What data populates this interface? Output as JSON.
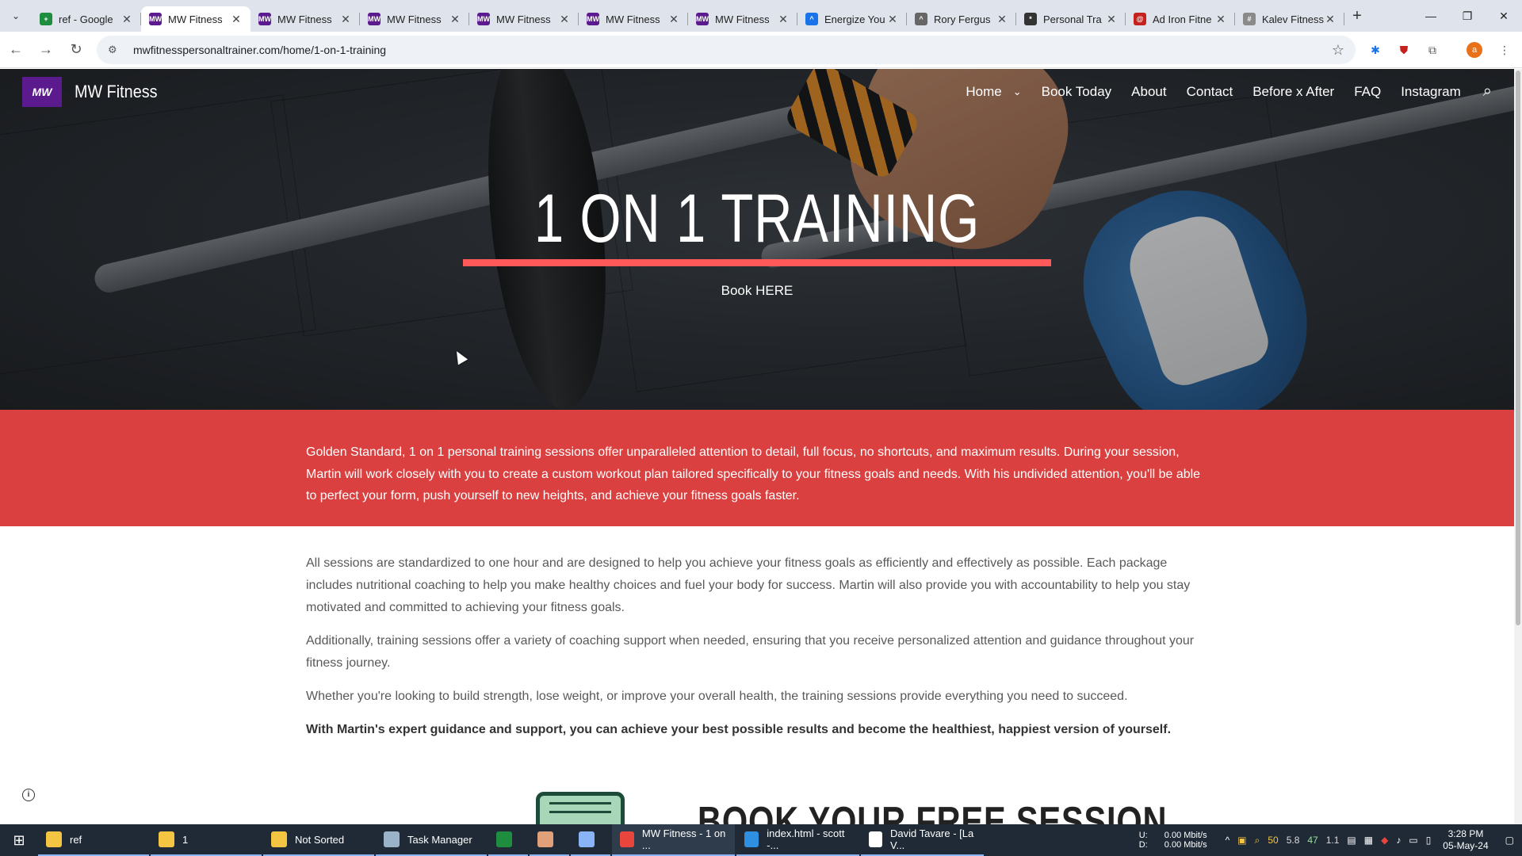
{
  "browser": {
    "tabs": [
      {
        "title": "ref - Google",
        "favicon_color": "#1e8e3e",
        "favicon_glyph": "+",
        "active": false
      },
      {
        "title": "MW Fitness",
        "favicon_color": "#5b1a8e",
        "favicon_glyph": "MW",
        "active": true
      },
      {
        "title": "MW Fitness",
        "favicon_color": "#5b1a8e",
        "favicon_glyph": "MW",
        "active": false
      },
      {
        "title": "MW Fitness",
        "favicon_color": "#5b1a8e",
        "favicon_glyph": "MW",
        "active": false
      },
      {
        "title": "MW Fitness",
        "favicon_color": "#5b1a8e",
        "favicon_glyph": "MW",
        "active": false
      },
      {
        "title": "MW Fitness",
        "favicon_color": "#5b1a8e",
        "favicon_glyph": "MW",
        "active": false
      },
      {
        "title": "MW Fitness",
        "favicon_color": "#5b1a8e",
        "favicon_glyph": "MW",
        "active": false
      },
      {
        "title": "Energize You",
        "favicon_color": "#1a73e8",
        "favicon_glyph": "^",
        "active": false
      },
      {
        "title": "Rory Fergus",
        "favicon_color": "#666666",
        "favicon_glyph": "^",
        "active": false
      },
      {
        "title": "Personal Tra",
        "favicon_color": "#333333",
        "favicon_glyph": "*",
        "active": false
      },
      {
        "title": "Ad Iron Fitne",
        "favicon_color": "#c5221f",
        "favicon_glyph": "@",
        "active": false
      },
      {
        "title": "Kalev Fitness",
        "favicon_color": "#8a8a8a",
        "favicon_glyph": "#",
        "active": false
      }
    ],
    "url": "mwfitnesspersonaltrainer.com/home/1-on-1-training",
    "profile_initial": "a"
  },
  "site": {
    "logo_text": "MW",
    "brand": "MW Fitness",
    "nav": [
      "Home",
      "Book Today",
      "About",
      "Contact",
      "Before x After",
      "FAQ",
      "Instagram"
    ],
    "hero_title": "1 ON 1 TRAINING",
    "hero_button": "Book HERE",
    "intro": "Golden Standard, 1 on 1 personal training sessions offer unparalleled attention to detail, full focus, no shortcuts, and maximum results. During your session, Martin will work closely with you to create a custom workout plan tailored specifically to your fitness goals and needs. With his undivided attention, you'll be able to perfect your form, push yourself to new heights, and achieve your fitness goals faster.",
    "paragraphs": [
      "All sessions are standardized to one hour and are designed to help you achieve your fitness goals as efficiently and effectively as possible. Each package includes nutritional coaching to help you make healthy choices and fuel your body for success. Martin will also provide you with accountability to help you stay motivated and committed to achieving your fitness goals.",
      "Additionally, training sessions offer a variety of coaching support when needed, ensuring that you receive personalized attention and guidance throughout your fitness journey.",
      "Whether you're looking to build strength, lose weight, or improve your overall health, the training sessions provide everything you need to succeed."
    ],
    "closing": "With Martin's expert guidance and support, you can achieve your best possible results and become the healthiest, happiest version of yourself.",
    "next_heading": "BOOK YOUR FREE SESSION",
    "accent_color": "#ff5959",
    "band_color": "#d9403f"
  },
  "taskbar": {
    "items": [
      {
        "label": "ref",
        "icon": "folder-icon",
        "color": "#f4c542"
      },
      {
        "label": "1",
        "icon": "folder-icon",
        "color": "#f4c542"
      },
      {
        "label": "Not Sorted",
        "icon": "folder-icon",
        "color": "#f4c542"
      },
      {
        "label": "Task Manager",
        "icon": "task-manager-icon",
        "color": "#9ab3c9"
      },
      {
        "label": "",
        "icon": "sheets-icon",
        "color": "#1e8e3e"
      },
      {
        "label": "",
        "icon": "app-icon",
        "color": "#e0a07a"
      },
      {
        "label": "",
        "icon": "notepad-icon",
        "color": "#8ab4f8"
      },
      {
        "label": "MW Fitness - 1 on ...",
        "icon": "chrome-icon",
        "color": "#e8453c"
      },
      {
        "label": "index.html - scott -...",
        "icon": "vscode-icon",
        "color": "#2f8fe0"
      },
      {
        "label": "David Tavare - [La V...",
        "icon": "app-icon",
        "color": "#ffffff"
      }
    ],
    "net_up": "0.00 Mbit/s",
    "net_down": "0.00 Mbit/s",
    "net_up_label": "U:",
    "net_down_label": "D:",
    "tray_numbers": [
      "50",
      "5.8",
      "47",
      "1.1"
    ],
    "time": "3:28 PM",
    "date": "05-May-24"
  }
}
